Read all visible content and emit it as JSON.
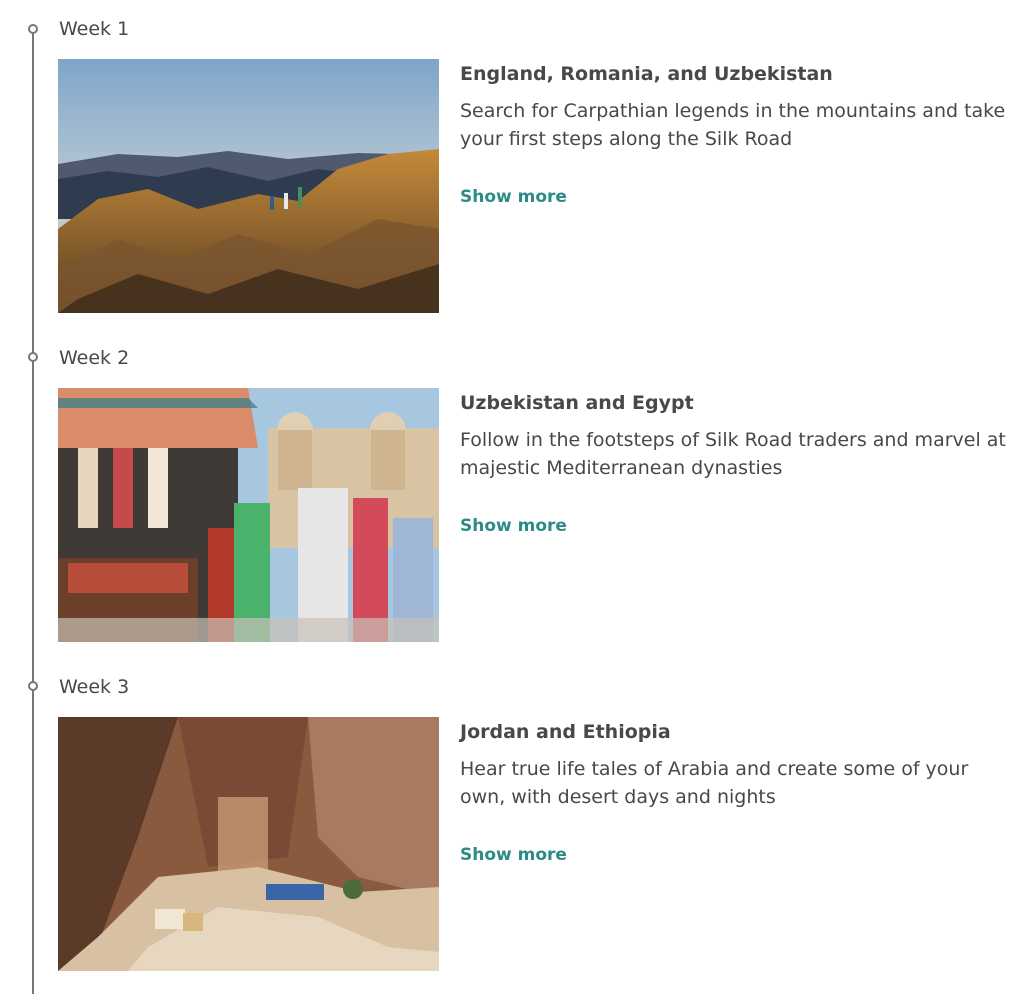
{
  "weeks": [
    {
      "label": "Week 1",
      "title": "England, Romania, and Uzbekistan",
      "description": "Search for Carpathian legends in the mountains and take your first steps along the Silk Road",
      "show_more": "Show more",
      "image_alt": "Hikers standing on golden rocky mountain ridge at sunset"
    },
    {
      "label": "Week 2",
      "title": "Uzbekistan and Egypt",
      "description": "Follow in the footsteps of Silk Road traders and marvel at majestic Mediterranean dynasties",
      "show_more": "Show more",
      "image_alt": "Market stalls with colorful textiles and people walking near domed buildings"
    },
    {
      "label": "Week 3",
      "title": "Jordan and Ethiopia",
      "description": "Hear true life tales of Arabia and create some of your own, with desert days and nights",
      "show_more": "Show more",
      "image_alt": "Aerial view of rock-cut facades and sandy valley with camels"
    }
  ],
  "colors": {
    "link": "#2c8b86",
    "text": "#484848",
    "timeline": "#767676"
  }
}
